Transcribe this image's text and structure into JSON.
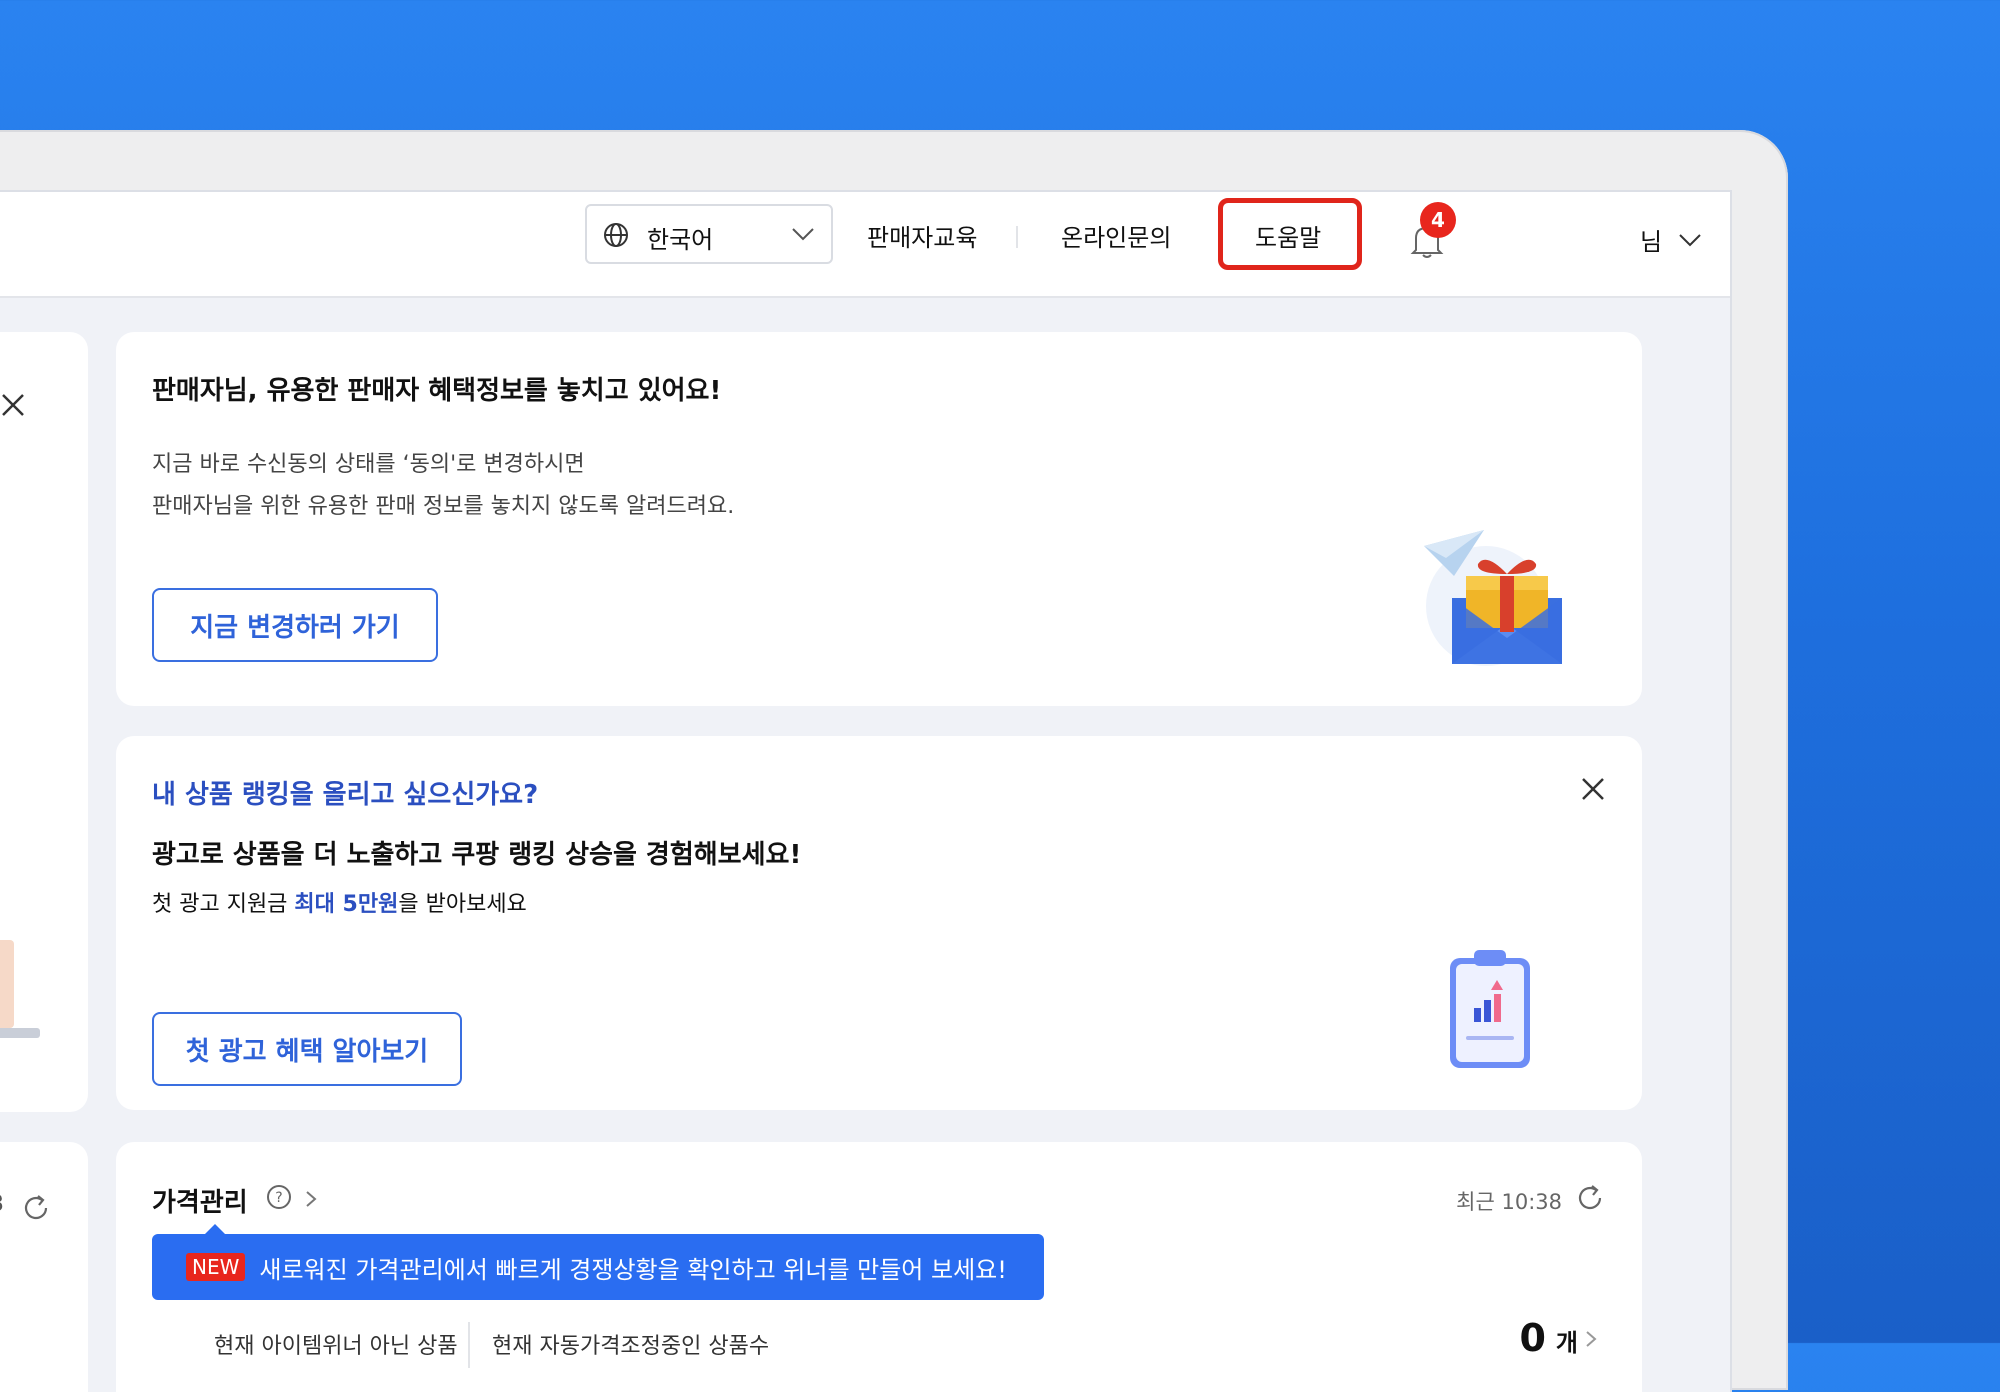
{
  "topbar": {
    "language": "한국어",
    "links": [
      "판매자교육",
      "온라인문의"
    ],
    "help": "도움말",
    "notification_count": "4",
    "user_suffix": "님"
  },
  "left_partial": {
    "digit": "3"
  },
  "benefit_card": {
    "title": "판매자님, 유용한 판매자 혜택정보를 놓치고 있어요!",
    "desc_line1": "지금 바로 수신동의 상태를 ‘동의'로 변경하시면",
    "desc_line2": "판매자님을 위한 유용한 판매 정보를 놓치지 않도록 알려드려요.",
    "button": "지금 변경하러 가기"
  },
  "ad_card": {
    "subtitle": "내 상품 랭킹을 올리고 싶으신가요?",
    "title": "광고로 상품을 더 노출하고 쿠팡 랭킹 상승을 경험해보세요!",
    "line_prefix": "첫 광고 지원금 ",
    "line_highlight": "최대 5만원",
    "line_suffix": "을 받아보세요",
    "button": "첫 광고 혜택 알아보기"
  },
  "price_card": {
    "title": "가격관리",
    "time": "최근 10:38",
    "tooltip_tag": "NEW",
    "tooltip_text": "새로워진 가격관리에서 빠르게 경쟁상황을 확인하고 위너를 만들어 보세요!",
    "label1": "현재 아이템위너 아닌 상품",
    "label2": "현재 자동가격조정중인 상품수",
    "count": "0",
    "unit": "개"
  },
  "colors": {
    "background": "#1e6fde",
    "accent_blue": "#2a6df1",
    "help_highlight": "#e0251b",
    "badge_red": "#e8261d"
  }
}
